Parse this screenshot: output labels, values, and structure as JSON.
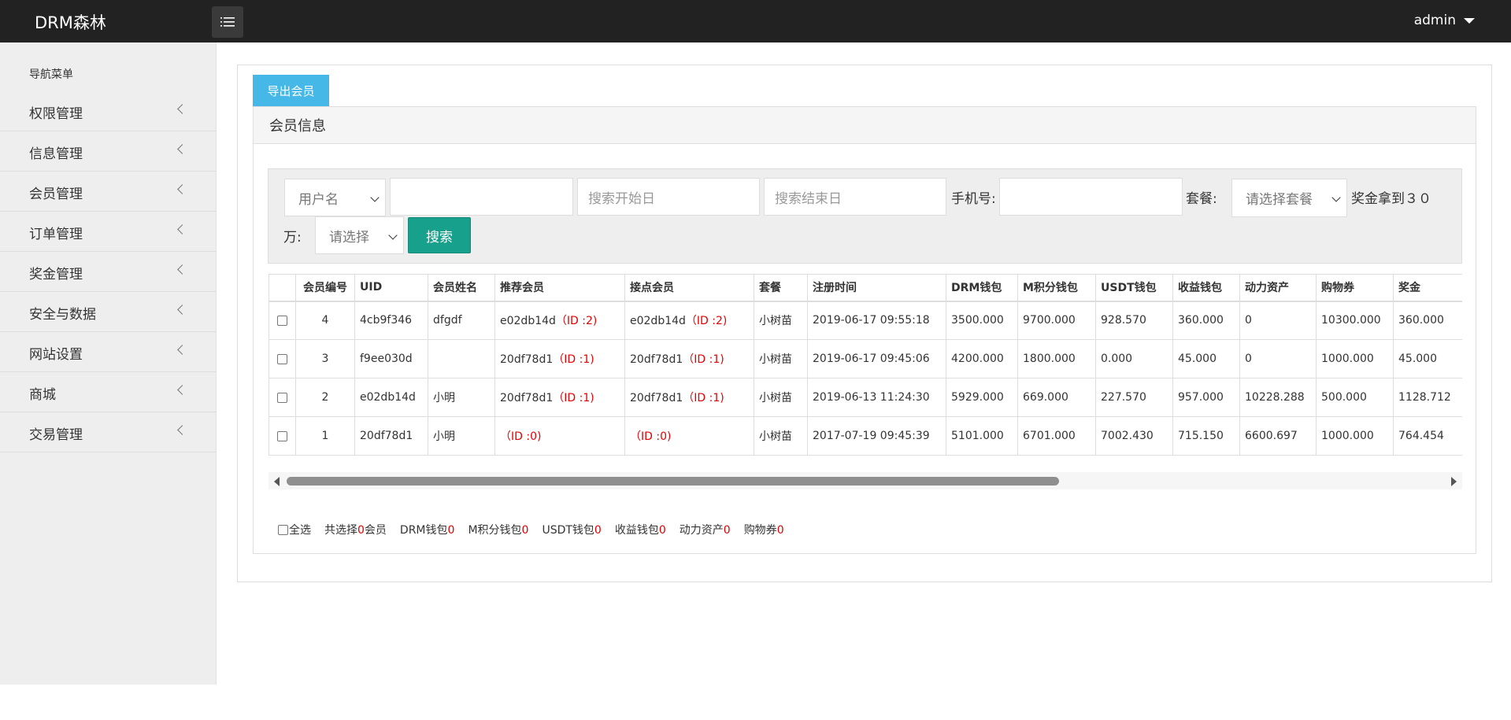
{
  "header": {
    "brand": "DRM森林",
    "user": "admin"
  },
  "sidebar": {
    "title": "导航菜单",
    "items": [
      {
        "label": "权限管理"
      },
      {
        "label": "信息管理"
      },
      {
        "label": "会员管理"
      },
      {
        "label": "订单管理"
      },
      {
        "label": "奖金管理"
      },
      {
        "label": "安全与数据"
      },
      {
        "label": "网站设置"
      },
      {
        "label": "商城"
      },
      {
        "label": "交易管理"
      }
    ]
  },
  "main": {
    "export_label": "导出会员",
    "panel_title": "会员信息"
  },
  "search": {
    "field_select": "用户名",
    "keyword_value": "",
    "start_placeholder": "搜索开始日",
    "end_placeholder": "搜索结束日",
    "phone_label": "手机号:",
    "phone_value": "",
    "package_label": "套餐:",
    "package_select": "请选择套餐",
    "bonus_label_1": "奖金拿到３０",
    "bonus_label_2": "万:",
    "bonus_select": "请选择",
    "search_label": "搜索"
  },
  "table": {
    "headers": [
      "会员编号",
      "UID",
      "会员姓名",
      "推荐会员",
      "接点会员",
      "套餐",
      "注册时间",
      "DRM钱包",
      "M积分钱包",
      "USDT钱包",
      "收益钱包",
      "动力资产",
      "购物券",
      "奖金"
    ],
    "rows": [
      {
        "no": "4",
        "uid": "4cb9f346",
        "name": "dfgdf",
        "ref_name": "e02db14d",
        "ref_id": "（ID :2)",
        "node_name": "e02db14d",
        "node_id": "（ID :2)",
        "package": "小树苗",
        "reg_time": "2019-06-17 09:55:18",
        "drm": "3500.000",
        "mpoint": "9700.000",
        "usdt": "928.570",
        "income": "360.000",
        "power": "0",
        "coupon": "10300.000",
        "bonus": "360.000"
      },
      {
        "no": "3",
        "uid": "f9ee030d",
        "name": "",
        "ref_name": "20df78d1",
        "ref_id": "（ID :1)",
        "node_name": "20df78d1",
        "node_id": "（ID :1)",
        "package": "小树苗",
        "reg_time": "2019-06-17 09:45:06",
        "drm": "4200.000",
        "mpoint": "1800.000",
        "usdt": "0.000",
        "income": "45.000",
        "power": "0",
        "coupon": "1000.000",
        "bonus": "45.000"
      },
      {
        "no": "2",
        "uid": "e02db14d",
        "name": "小明",
        "ref_name": "20df78d1",
        "ref_id": "（ID :1)",
        "node_name": "20df78d1",
        "node_id": "（ID :1)",
        "package": "小树苗",
        "reg_time": "2019-06-13 11:24:30",
        "drm": "5929.000",
        "mpoint": "669.000",
        "usdt": "227.570",
        "income": "957.000",
        "power": "10228.288",
        "coupon": "500.000",
        "bonus": "1128.712"
      },
      {
        "no": "1",
        "uid": "20df78d1",
        "name": "小明",
        "ref_name": "",
        "ref_id": "（ID :0)",
        "node_name": "",
        "node_id": "（ID :0)",
        "package": "小树苗",
        "reg_time": "2017-07-19 09:45:39",
        "drm": "5101.000",
        "mpoint": "6701.000",
        "usdt": "7002.430",
        "income": "715.150",
        "power": "6600.697",
        "coupon": "1000.000",
        "bonus": "764.454"
      }
    ]
  },
  "summary": {
    "select_all": "全选",
    "selected_prefix": "共选择",
    "selected_count": "0",
    "selected_suffix": "会员",
    "drm_label": "DRM钱包",
    "drm_value": "0",
    "mpoint_label": "M积分钱包",
    "mpoint_value": "0",
    "usdt_label": "USDT钱包",
    "usdt_value": "0",
    "income_label": "收益钱包",
    "income_value": "0",
    "power_label": "动力资产",
    "power_value": "0",
    "coupon_label": "购物券",
    "coupon_value": "0"
  }
}
